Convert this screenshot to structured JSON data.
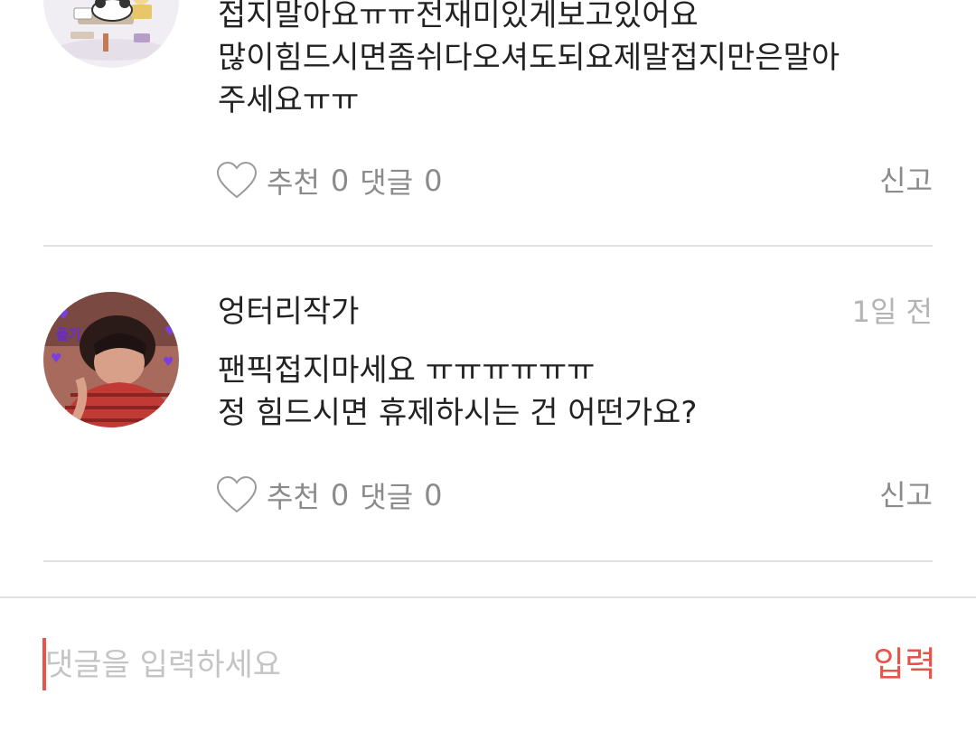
{
  "comments": [
    {
      "body_lines": [
        "접지말아요ㅠㅠ전재미있게보고있어요",
        "많이힘드시면좀쉬다오셔도되요제말접지만은말아",
        "주세요ㅠㅠ"
      ],
      "like_label": "추천",
      "like_count": "0",
      "reply_label": "댓글",
      "reply_count": "0",
      "report_label": "신고"
    },
    {
      "author": "엉터리작가",
      "time": "1일 전",
      "body_lines": [
        "팬픽접지마세요 ㅠㅠㅠㅠㅠㅠ",
        "정 힘드시면 휴제하시는 건 어떤가요?"
      ],
      "like_label": "추천",
      "like_count": "0",
      "reply_label": "댓글",
      "reply_count": "0",
      "report_label": "신고",
      "avatar_text": "율기"
    }
  ],
  "comment_input": {
    "placeholder": "댓글을 입력하세요",
    "submit_label": "입력"
  },
  "colors": {
    "accent": "#e8534a",
    "text": "#222222",
    "muted": "#8b8b8b",
    "divider": "#e2e2e2"
  }
}
